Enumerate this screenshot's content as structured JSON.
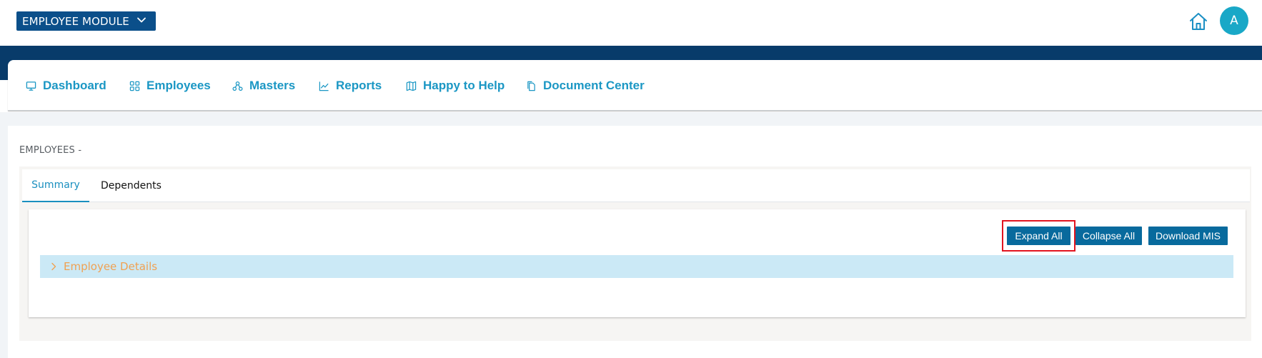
{
  "header": {
    "module_selector": "EMPLOYEE MODULE",
    "avatar_initial": "A"
  },
  "nav": {
    "items": [
      {
        "label": "Dashboard",
        "icon": "monitor-icon"
      },
      {
        "label": "Employees",
        "icon": "grid-icon"
      },
      {
        "label": "Masters",
        "icon": "sitemap-icon"
      },
      {
        "label": "Reports",
        "icon": "line-chart-icon"
      },
      {
        "label": "Happy to Help",
        "icon": "map-icon"
      },
      {
        "label": "Document Center",
        "icon": "documents-icon"
      }
    ]
  },
  "page": {
    "section_title": "EMPLOYEES -"
  },
  "tabs": [
    {
      "label": "Summary",
      "active": true
    },
    {
      "label": "Dependents",
      "active": false
    }
  ],
  "actions": {
    "expand_all": "Expand All",
    "collapse_all": "Collapse All",
    "download_mis": "Download MIS"
  },
  "accordion": {
    "label": "Employee Details",
    "expanded": false
  },
  "colors": {
    "brand_dark": "#083b6a",
    "module_button": "#0b4f8a",
    "nav_text": "#1b97c4",
    "action_button": "#086a9d",
    "accordion_bg": "#cbe9f6",
    "accordion_text": "#f0a152",
    "highlight": "#e2141f"
  }
}
